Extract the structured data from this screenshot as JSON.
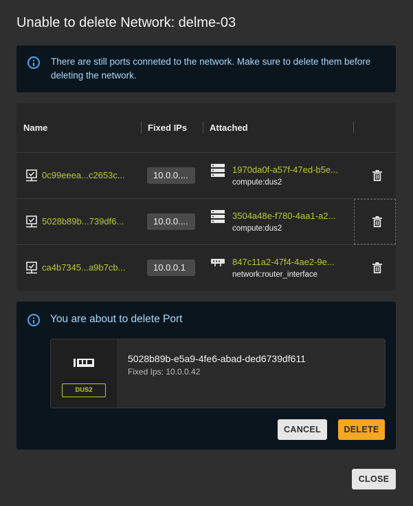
{
  "dialog": {
    "title": "Unable to delete Network: delme-03",
    "banner_text": "There are still ports conneted to the network. Make sure to delete them before deleting the network.",
    "close_label": "CLOSE"
  },
  "table": {
    "columns": [
      "Name",
      "Fixed IPs",
      "Attached"
    ],
    "rows": [
      {
        "name": "0c99eeea...c2653c...",
        "ip": "10.0.0....",
        "attached_id": "1970da0f-a57f-47ed-b5e...",
        "attached_type": "compute:dus2",
        "attached_icon": "server-icon"
      },
      {
        "name": "5028b89b...739df6...",
        "ip": "10.0.0....",
        "attached_id": "3504a48e-f780-4aa1-a2...",
        "attached_type": "compute:dus2",
        "attached_icon": "server-icon"
      },
      {
        "name": "ca4b7345...a9b7cb...",
        "ip": "10.0.0.1",
        "attached_id": "847c11a2-47f4-4ae2-9e...",
        "attached_type": "network:router_interface",
        "attached_icon": "router-icon"
      }
    ]
  },
  "confirm": {
    "title": "You are about to delete Port",
    "port_id": "5028b89b-e5a9-4fe6-abad-ded6739df611",
    "fixed_ips": "Fixed Ips: 10.0.0.42",
    "badge": "DUS2",
    "cancel_label": "CANCEL",
    "delete_label": "DELETE"
  },
  "colors": {
    "link": "#b8cc2f",
    "info": "#4aa8f0",
    "delete_accent": "#f5a623"
  }
}
